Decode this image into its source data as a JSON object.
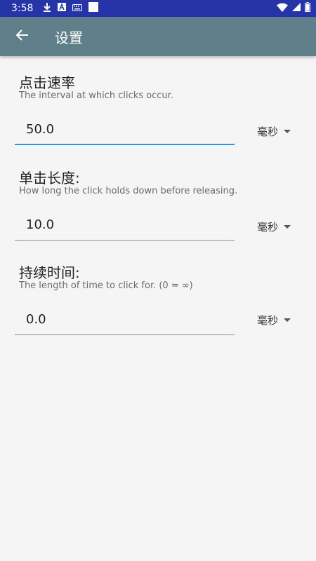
{
  "status_bar": {
    "time": "3:58"
  },
  "app_bar": {
    "title": "设置"
  },
  "settings": [
    {
      "label": "点击速率",
      "description": "The interval at which clicks occur.",
      "value": "50.0",
      "unit": "毫秒",
      "focused": true
    },
    {
      "label": "单击长度:",
      "description": "How long the click holds down before releasing.",
      "value": "10.0",
      "unit": "毫秒",
      "focused": false
    },
    {
      "label": "持续时间:",
      "description": "The length of time to click for. (0 = ∞)",
      "value": "0.0",
      "unit": "毫秒",
      "focused": false
    }
  ],
  "colors": {
    "status_bar": "#2535a8",
    "app_bar": "#5f7f8a",
    "accent": "#2196f3",
    "background": "#f5f5f5"
  }
}
